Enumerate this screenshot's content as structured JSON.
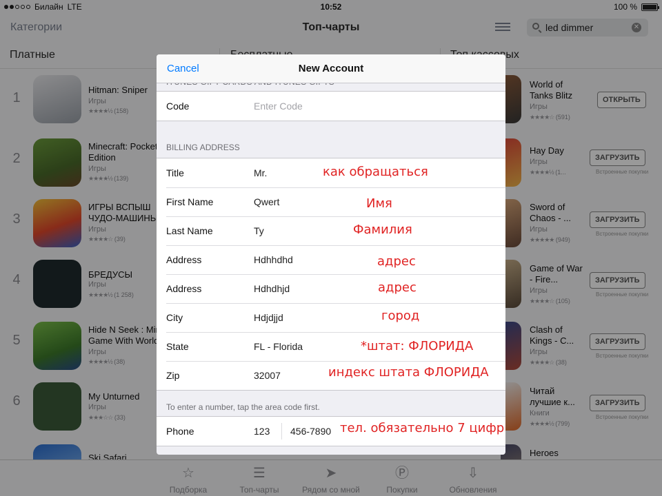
{
  "status": {
    "carrier": "Билайн",
    "network": "LTE",
    "time": "10:52",
    "battery": "100 %",
    "battery_level": 1.0
  },
  "nav": {
    "left": "Категории",
    "title": "Топ-чарты",
    "search_query": "led dimmer",
    "list_icon": "list-icon",
    "clear_icon": "clear-icon"
  },
  "segments": {
    "paid": "Платные",
    "free": "Бесплатные",
    "top_grossing": "Топ кассовых"
  },
  "paid_apps": [
    {
      "rank": "1",
      "name": "Hitman: Sniper",
      "category": "Игры",
      "stars": "★★★★½",
      "count": "(158)"
    },
    {
      "rank": "2",
      "name": "Minecraft: Pocket Edition",
      "category": "Игры",
      "stars": "★★★★½",
      "count": "(139)"
    },
    {
      "rank": "3",
      "name": "ИГРЫ ВСПЫШ ЧУДО-МАШИНЫ",
      "category": "Игры",
      "stars": "★★★★☆",
      "count": "(39)"
    },
    {
      "rank": "4",
      "name": "БРЕДУСЫ",
      "category": "Игры",
      "stars": "★★★★½",
      "count": "(1 258)"
    },
    {
      "rank": "5",
      "name": "Hide N Seek : Mini Game With World",
      "category": "Игры",
      "stars": "★★★★½",
      "count": "(38)"
    },
    {
      "rank": "6",
      "name": "My Unturned",
      "category": "Игры",
      "stars": "★★★☆☆",
      "count": "(33)"
    },
    {
      "rank": "",
      "name": "Ski Safari",
      "category": "",
      "stars": "",
      "count": ""
    }
  ],
  "grossing_apps": [
    {
      "name": "World of Tanks Blitz",
      "category": "Игры",
      "stars": "★★★★☆",
      "count": "(591)",
      "button": "ОТКРЫТЬ",
      "inapp": ""
    },
    {
      "name": "Hay Day",
      "category": "Игры",
      "stars": "★★★★½",
      "count": "(1...",
      "button": "ЗАГРУЗИТЬ",
      "inapp": "Встроенные покупки"
    },
    {
      "name": "Sword of Chaos - ...",
      "category": "Игры",
      "stars": "★★★★★",
      "count": "(949)",
      "button": "ЗАГРУЗИТЬ",
      "inapp": "Встроенные покупки"
    },
    {
      "name": "Game of War - Fire...",
      "category": "Игры",
      "stars": "★★★★☆",
      "count": "(105)",
      "button": "ЗАГРУЗИТЬ",
      "inapp": "Встроенные покупки"
    },
    {
      "name": "Clash of Kings - C...",
      "category": "Игры",
      "stars": "★★★★☆",
      "count": "(38)",
      "button": "ЗАГРУЗИТЬ",
      "inapp": "Встроенные покупки"
    },
    {
      "name": "Читай лучшие к...",
      "category": "Книги",
      "stars": "★★★★½",
      "count": "(799)",
      "button": "ЗАГРУЗИТЬ",
      "inapp": "Встроенные покупки"
    },
    {
      "name": "Heroes",
      "category": "",
      "stars": "",
      "count": "",
      "button": "",
      "inapp": ""
    }
  ],
  "tabs": [
    {
      "label": "Подборка",
      "icon": "☆"
    },
    {
      "label": "Топ-чарты",
      "icon": "☰"
    },
    {
      "label": "Рядом со мной",
      "icon": "➤"
    },
    {
      "label": "Покупки",
      "icon": "Ⓟ"
    },
    {
      "label": "Обновления",
      "icon": "⇩"
    }
  ],
  "modal": {
    "cancel": "Cancel",
    "title": "New Account",
    "cut_header": "ITUNES GIFT CARDS AND ITUNES GIFTS",
    "code_label": "Code",
    "code_placeholder": "Enter Code",
    "billing_header": "BILLING ADDRESS",
    "fields": [
      {
        "label": "Title",
        "value": "Mr."
      },
      {
        "label": "First Name",
        "value": "Qwert"
      },
      {
        "label": "Last Name",
        "value": "Ty"
      },
      {
        "label": "Address",
        "value": "Hdhhdhd"
      },
      {
        "label": "Address",
        "value": "Hdhdhjd"
      },
      {
        "label": "City",
        "value": "Hdjdjjd"
      },
      {
        "label": "State",
        "value": "FL - Florida"
      },
      {
        "label": "Zip",
        "value": "32007"
      }
    ],
    "hint": "To enter a number, tap the area code first.",
    "phone_label": "Phone",
    "phone_area": "123",
    "phone_number": "456-7890"
  },
  "annotations": [
    "как обращаться",
    "Имя",
    "Фамилия",
    "адрес",
    "адрес",
    "город",
    "*штат: ФЛОРИДА",
    "индекс штата ФЛОРИДА",
    "тел. обязательно 7 цифр"
  ],
  "colors": {
    "accent": "#007aff",
    "annotation": "#e02323"
  }
}
